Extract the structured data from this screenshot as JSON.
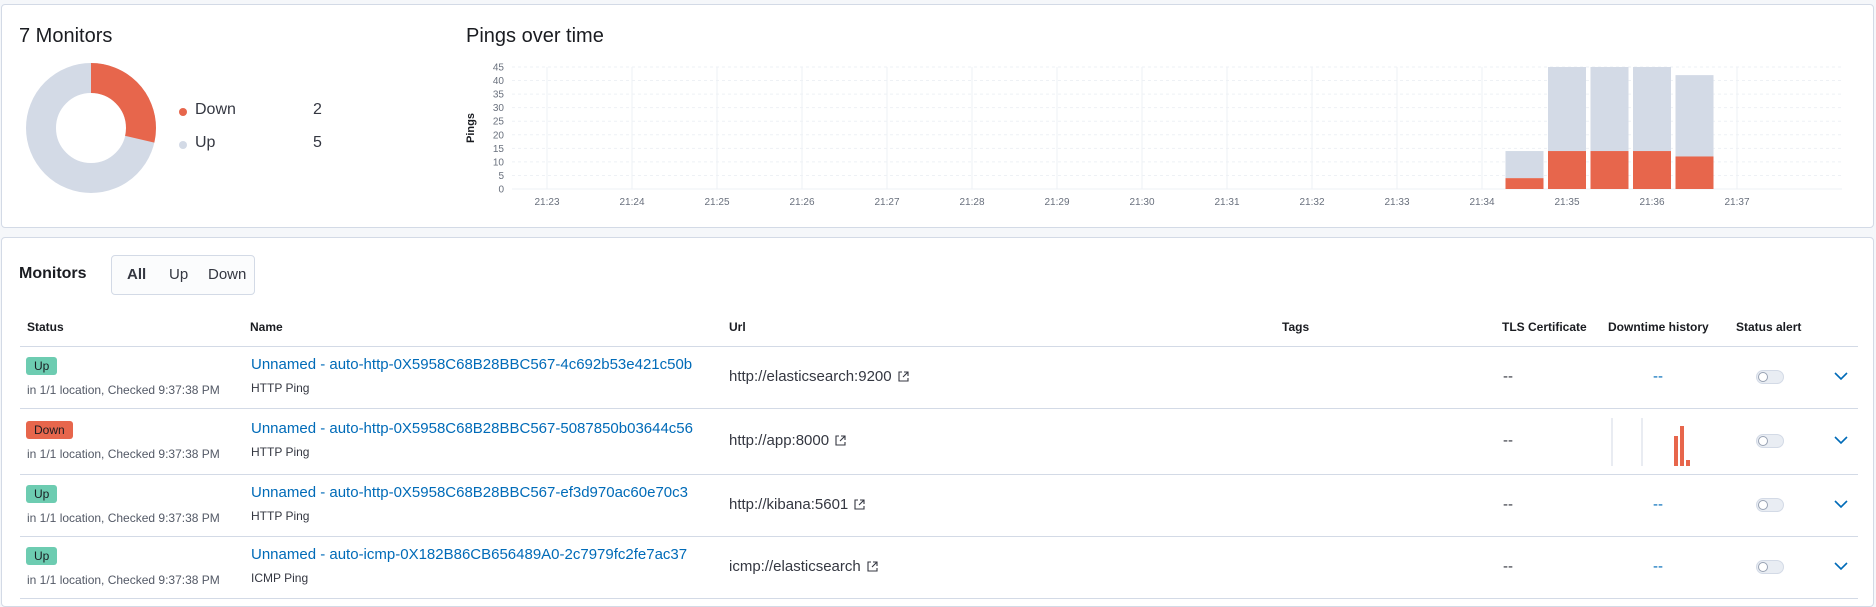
{
  "summary": {
    "monitors_title": "7 Monitors",
    "donut": {
      "down_color": "#e7664c",
      "up_color": "#d3dae6",
      "legend": [
        {
          "label": "Down",
          "value": "2"
        },
        {
          "label": "Up",
          "value": "5"
        }
      ]
    },
    "pings_title": "Pings over time",
    "chart_data": {
      "type": "bar",
      "title": "Pings over time",
      "ylabel": "Pings",
      "xlabel": "",
      "ylim": [
        0,
        45
      ],
      "y_ticks": [
        "0",
        "5",
        "10",
        "15",
        "20",
        "25",
        "30",
        "35",
        "40",
        "45"
      ],
      "x_ticks": [
        "21:23",
        "21:24",
        "21:25",
        "21:26",
        "21:27",
        "21:28",
        "21:29",
        "21:30",
        "21:31",
        "21:32",
        "21:33",
        "21:34",
        "21:35",
        "21:36",
        "21:37"
      ],
      "stacked": true,
      "grid": true,
      "bars": [
        {
          "x": "21:34.5",
          "down": 4,
          "up": 10
        },
        {
          "x": "21:35",
          "down": 14,
          "up": 35
        },
        {
          "x": "21:35.5",
          "down": 14,
          "up": 35
        },
        {
          "x": "21:36",
          "down": 14,
          "up": 35
        },
        {
          "x": "21:36.5",
          "down": 12,
          "up": 30
        }
      ],
      "series": [
        {
          "name": "Down",
          "color": "#e7664c"
        },
        {
          "name": "Up",
          "color": "#d3dae6"
        }
      ]
    }
  },
  "monitors": {
    "title": "Monitors",
    "filters": [
      "All",
      "Up",
      "Down"
    ],
    "columns": [
      "Status",
      "Name",
      "Url",
      "Tags",
      "TLS Certificate",
      "Downtime history",
      "Status alert"
    ],
    "rows": [
      {
        "status": "Up",
        "status_sub": "in 1/1 location, Checked 9:37:38 PM",
        "name": "Unnamed - auto-http-0X5958C68B28BBC567-4c692b53e421c50b",
        "type": "HTTP Ping",
        "url": "http://elasticsearch:9200",
        "tls": "--",
        "downtime": "--"
      },
      {
        "status": "Down",
        "status_sub": "in 1/1 location, Checked 9:37:38 PM",
        "name": "Unnamed - auto-http-0X5958C68B28BBC567-5087850b03644c56",
        "type": "HTTP Ping",
        "url": "http://app:8000",
        "tls": "--",
        "downtime": ""
      },
      {
        "status": "Up",
        "status_sub": "in 1/1 location, Checked 9:37:38 PM",
        "name": "Unnamed - auto-http-0X5958C68B28BBC567-ef3d970ac60e70c3",
        "type": "HTTP Ping",
        "url": "http://kibana:5601",
        "tls": "--",
        "downtime": "--"
      },
      {
        "status": "Up",
        "status_sub": "in 1/1 location, Checked 9:37:38 PM",
        "name": "Unnamed - auto-icmp-0X182B86CB656489A0-2c7979fc2fe7ac37",
        "type": "ICMP Ping",
        "url": "icmp://elasticsearch",
        "tls": "--",
        "downtime": "--"
      }
    ]
  }
}
